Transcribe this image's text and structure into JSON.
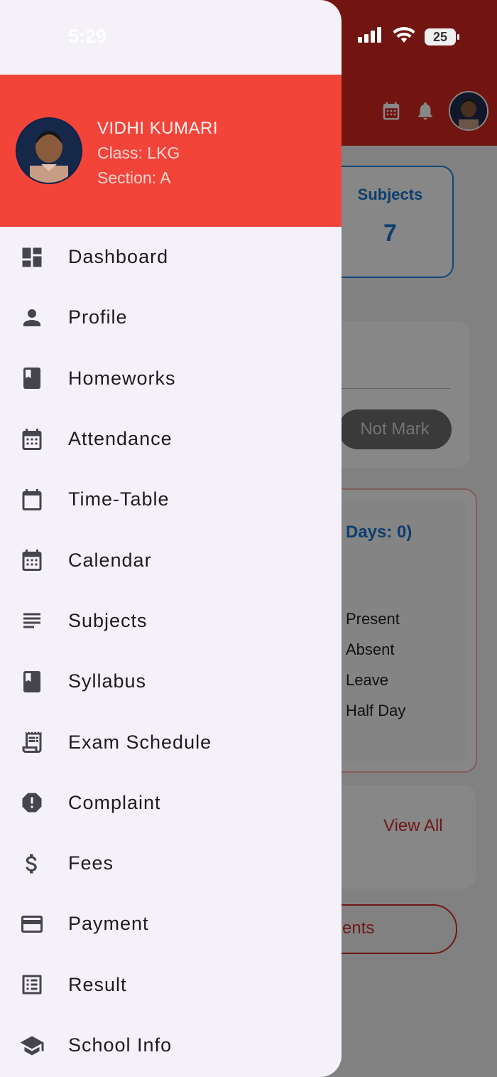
{
  "status_bar": {
    "time": "5:29",
    "battery": "25"
  },
  "background": {
    "subjects_card": {
      "label": "Subjects",
      "value": "7"
    },
    "attendance_card": {
      "status_button": "Not Mark"
    },
    "days_card": {
      "title_partial": "Days: 0)",
      "legend": [
        "Present",
        "Absent",
        "Leave",
        "Half Day"
      ]
    },
    "view_all": "View All",
    "events_button_partial": "ents"
  },
  "drawer": {
    "user": {
      "name": "VIDHI KUMARI",
      "class": "Class: LKG",
      "section": "Section: A"
    },
    "items": [
      {
        "label": "Dashboard",
        "icon": "dashboard-icon"
      },
      {
        "label": "Profile",
        "icon": "person-icon"
      },
      {
        "label": "Homeworks",
        "icon": "book-icon"
      },
      {
        "label": "Attendance",
        "icon": "calendar-icon"
      },
      {
        "label": "Time-Table",
        "icon": "calendar-blank-icon"
      },
      {
        "label": "Calendar",
        "icon": "calendar-icon"
      },
      {
        "label": "Subjects",
        "icon": "subject-lines-icon"
      },
      {
        "label": "Syllabus",
        "icon": "book-icon"
      },
      {
        "label": "Exam Schedule",
        "icon": "receipt-icon"
      },
      {
        "label": "Complaint",
        "icon": "alert-octagon-icon"
      },
      {
        "label": "Fees",
        "icon": "dollar-icon"
      },
      {
        "label": "Payment",
        "icon": "credit-card-icon"
      },
      {
        "label": "Result",
        "icon": "list-box-icon"
      },
      {
        "label": "School Info",
        "icon": "school-cap-icon"
      }
    ]
  },
  "colors": {
    "drawer_header": "#f3443a",
    "app_header": "#d8261f",
    "drawer_bg": "#f5f1f8",
    "accent_blue": "#1976d2"
  }
}
